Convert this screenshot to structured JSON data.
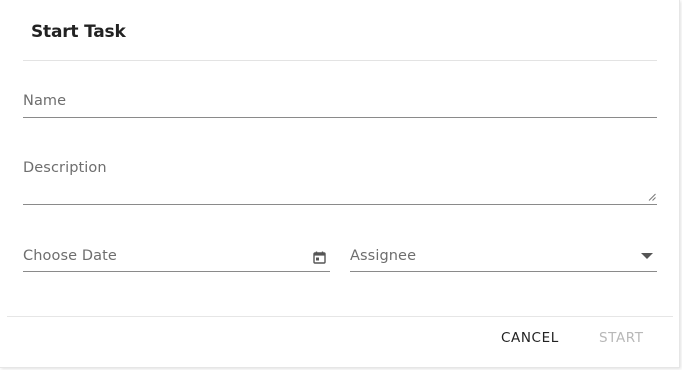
{
  "dialog": {
    "title": "Start Task"
  },
  "form": {
    "name_placeholder": "Name",
    "description_placeholder": "Description",
    "date_placeholder": "Choose Date",
    "assignee_placeholder": "Assignee"
  },
  "actions": {
    "cancel_label": "CANCEL",
    "start_label": "START",
    "start_disabled": true
  },
  "icons": {
    "date": "calendar-icon",
    "assignee": "chevron-down-icon",
    "description": "resize-handle-icon"
  },
  "colors": {
    "primary_text": "#222222",
    "placeholder_text": "#6e6e6e",
    "disabled_text": "#b8b8b8",
    "underline": "#8a8a8a"
  }
}
